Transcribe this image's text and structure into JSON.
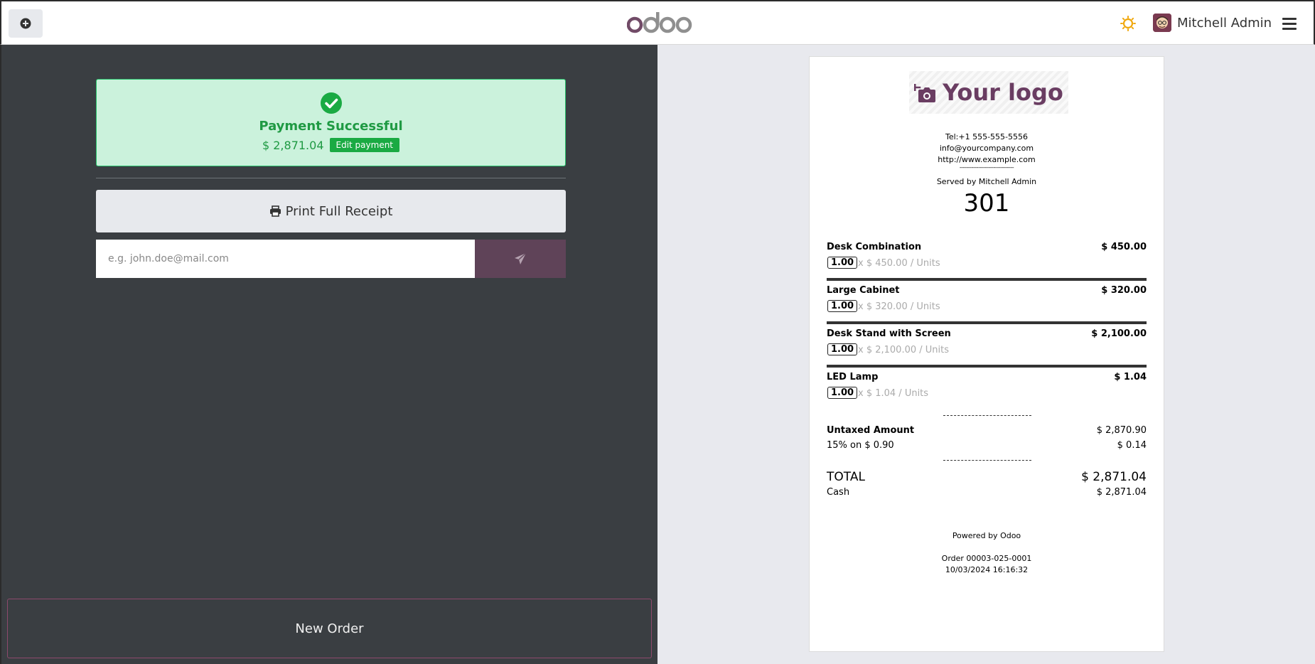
{
  "topbar": {
    "logo_text": "odoo",
    "user_name": "Mitchell Admin",
    "colors": {
      "accent": "#714b67",
      "sun": "#f0a80e"
    }
  },
  "payment": {
    "status": "Payment Successful",
    "amount": "$ 2,871.04",
    "edit_label": "Edit payment"
  },
  "actions": {
    "print_label": "Print Full Receipt",
    "email_placeholder": "e.g. john.doe@mail.com",
    "new_order_label": "New Order"
  },
  "receipt": {
    "logo_text": "Your logo",
    "tel": "Tel:+1 555-555-5556",
    "email": "info@yourcompany.com",
    "website": "http://www.example.com",
    "separator": "--------------------------------",
    "served_by": "Served by Mitchell Admin",
    "order_number": "301",
    "lines": [
      {
        "name": "Desk Combination",
        "price": "$ 450.00",
        "qty": "1.00",
        "unit": "x $ 450.00 / Units"
      },
      {
        "name": "Large Cabinet",
        "price": "$ 320.00",
        "qty": "1.00",
        "unit": "x $ 320.00 / Units"
      },
      {
        "name": "Desk Stand with Screen",
        "price": "$ 2,100.00",
        "qty": "1.00",
        "unit": "x $ 2,100.00 / Units"
      },
      {
        "name": "LED Lamp",
        "price": "$ 1.04",
        "qty": "1.00",
        "unit": "x $ 1.04 / Units"
      }
    ],
    "untaxed_label": "Untaxed Amount",
    "untaxed_value": "$ 2,870.90",
    "tax_label": "15% on $ 0.90",
    "tax_value": "$ 0.14",
    "total_label": "TOTAL",
    "total_value": "$ 2,871.04",
    "cash_label": "Cash",
    "cash_value": "$ 2,871.04",
    "powered_by": "Powered by Odoo",
    "order_ref": "Order 00003-025-0001",
    "datetime": "10/03/2024 16:16:32"
  }
}
